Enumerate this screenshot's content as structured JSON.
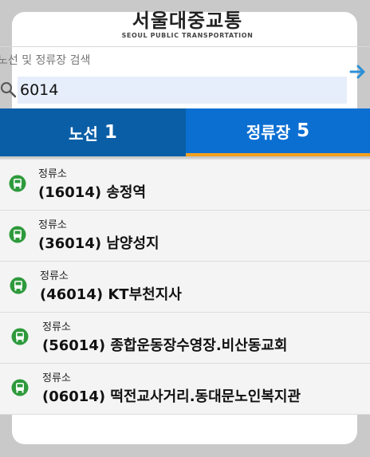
{
  "header": {
    "title": "서울대중교통",
    "subtitle": "SEOUL PUBLIC TRANSPORTATION"
  },
  "search": {
    "label": "노선 및 정류장 검색",
    "value": "6014"
  },
  "tabs": [
    {
      "label": "노선",
      "count": "1"
    },
    {
      "label": "정류장",
      "count": "5"
    }
  ],
  "colors": {
    "tab_routes": "#0a5ea6",
    "tab_stations": "#0b6fd2",
    "tab_indicator": "#f4a11d",
    "bus_icon": "#2e9a3c",
    "arrow": "#2a90d6"
  },
  "stations": [
    {
      "kind": "정류소",
      "name": "(16014) 송정역"
    },
    {
      "kind": "정류소",
      "name": "(36014) 남양성지"
    },
    {
      "kind": "정류소",
      "name": "(46014) KT부천지사"
    },
    {
      "kind": "정류소",
      "name": "(56014) 종합운동장수영장.비산동교회"
    },
    {
      "kind": "정류소",
      "name": "(06014) 떡전교사거리.동대문노인복지관"
    }
  ]
}
